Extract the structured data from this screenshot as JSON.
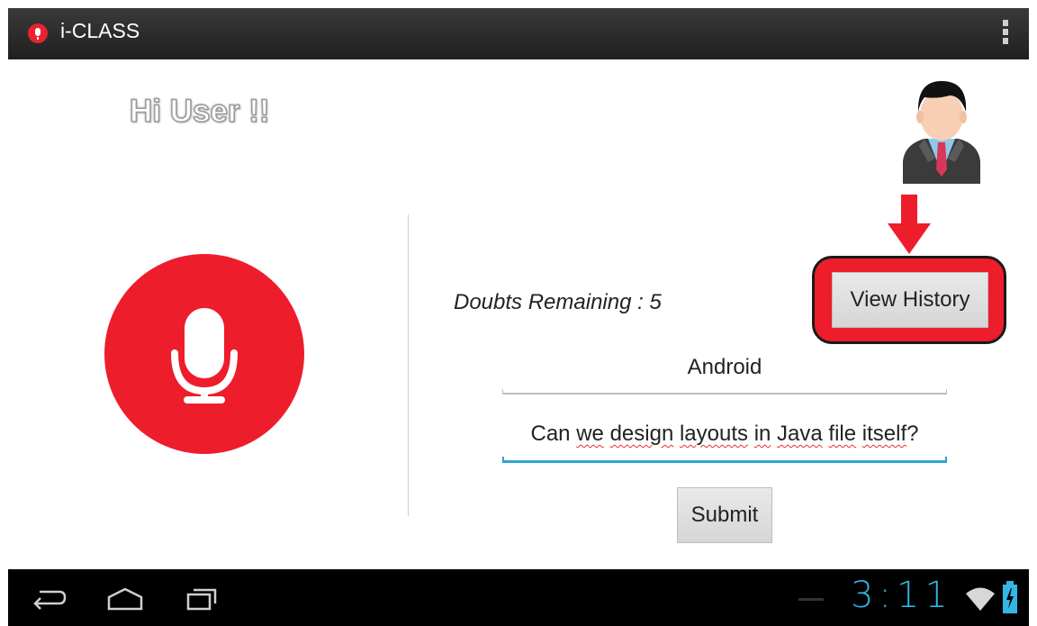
{
  "app": {
    "title": "i-CLASS"
  },
  "greeting": "Hi User !!",
  "doubts_remaining": "Doubts Remaining : 5",
  "buttons": {
    "view_history": "View History",
    "submit": "Submit"
  },
  "form": {
    "subject_value": "Android",
    "question_words": [
      "Can ",
      "we",
      " ",
      "design",
      " ",
      "layouts",
      " ",
      "in",
      " ",
      "Java",
      " ",
      "file",
      " ",
      "itself",
      "?"
    ]
  },
  "status_bar": {
    "time": "3:11"
  },
  "icons": {
    "app": "microphone-icon",
    "menu": "overflow-menu-icon",
    "mic": "microphone-icon",
    "avatar": "user-avatar-icon",
    "arrow": "arrow-down-icon",
    "nav_back": "back-icon",
    "nav_home": "home-icon",
    "nav_recent": "recent-apps-icon",
    "wifi": "wifi-icon",
    "battery": "battery-charging-icon"
  },
  "colors": {
    "accent_red": "#ee1d2b",
    "focus_blue": "#2fa4d0",
    "clock_blue": "#33b5e5"
  }
}
